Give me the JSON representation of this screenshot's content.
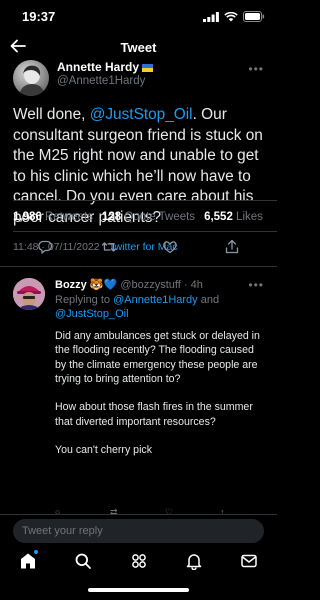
{
  "status_bar": {
    "time": "19:37"
  },
  "header": {
    "title": "Tweet"
  },
  "tweet": {
    "author_name": "Annette Hardy",
    "author_handle": "@Annette1Hardy",
    "text_before": "Well done, ",
    "mention": "@JustStop_Oil",
    "text_after": ". Our consultant surgeon friend is stuck on the M25 right now and unable to get to his clinic which he’ll now have to cancel. Do you even care about his poor cancer patients?",
    "time": "11:48",
    "date": "07/11/2022",
    "source": "Twitter for Mac",
    "retweets_count": "1,986",
    "retweets_label": "Retweets",
    "quotes_count": "128",
    "quotes_label": "Quote Tweets",
    "likes_count": "6,552",
    "likes_label": "Likes"
  },
  "reply": {
    "name": "Bozzy",
    "handle": "@bozzystuff",
    "age": "4h",
    "replying_prefix": "Replying to",
    "replying_to_1": "@Annette1Hardy",
    "replying_and": "and",
    "replying_to_2": "@JustStop_Oil",
    "paragraphs": [
      "Did any ambulances get stuck or delayed in the flooding recently?  The flooding caused by the climate emergency these people are trying to bring attention to?",
      "How about those flash fires in the summer that diverted important resources?",
      "You can't cherry pick"
    ]
  },
  "compose": {
    "placeholder": "Tweet your reply"
  },
  "icons": {
    "back": "back-arrow-icon",
    "reply": "reply-icon",
    "retweet": "retweet-icon",
    "like": "heart-icon",
    "share": "share-icon",
    "home": "home-icon",
    "search": "search-icon",
    "spaces": "spaces-icon",
    "notifications": "bell-icon",
    "messages": "mail-icon"
  },
  "colors": {
    "accent": "#1d9bf0",
    "background": "#000000",
    "secondary_text": "#71767b"
  }
}
